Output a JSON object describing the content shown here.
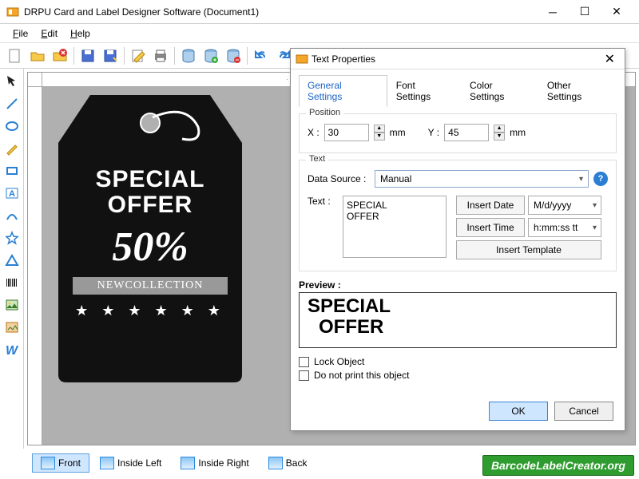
{
  "window": {
    "title": "DRPU Card and Label Designer Software (Document1)"
  },
  "menu": {
    "file": "File",
    "edit": "Edit",
    "help": "Help"
  },
  "bottom_tabs": {
    "front": "Front",
    "inside_left": "Inside Left",
    "inside_right": "Inside Right",
    "back": "Back"
  },
  "brand": "BarcodeLabelCreator.org",
  "tag": {
    "line1": "SPECIAL",
    "line2": "OFFER",
    "percent": "50%",
    "stripe": "NEWCOLLECTION",
    "stars": "★ ★ ★ ★ ★ ★"
  },
  "dialog": {
    "title": "Text Properties",
    "tabs": {
      "general": "General Settings",
      "font": "Font Settings",
      "color": "Color Settings",
      "other": "Other Settings"
    },
    "position": {
      "label": "Position",
      "x_label": "X :",
      "x_value": "30",
      "x_unit": "mm",
      "y_label": "Y :",
      "y_value": "45",
      "y_unit": "mm"
    },
    "text_group": {
      "label": "Text",
      "datasource_label": "Data Source :",
      "datasource_value": "Manual",
      "text_label": "Text :",
      "text_value": "SPECIAL\nOFFER",
      "insert_date": "Insert Date",
      "date_format": "M/d/yyyy",
      "insert_time": "Insert Time",
      "time_format": "h:mm:ss tt",
      "insert_template": "Insert Template"
    },
    "preview_label": "Preview :",
    "preview_line1": "SPECIAL",
    "preview_line2": "OFFER",
    "lock": "Lock Object",
    "noprint": "Do not print this object",
    "ok": "OK",
    "cancel": "Cancel"
  }
}
